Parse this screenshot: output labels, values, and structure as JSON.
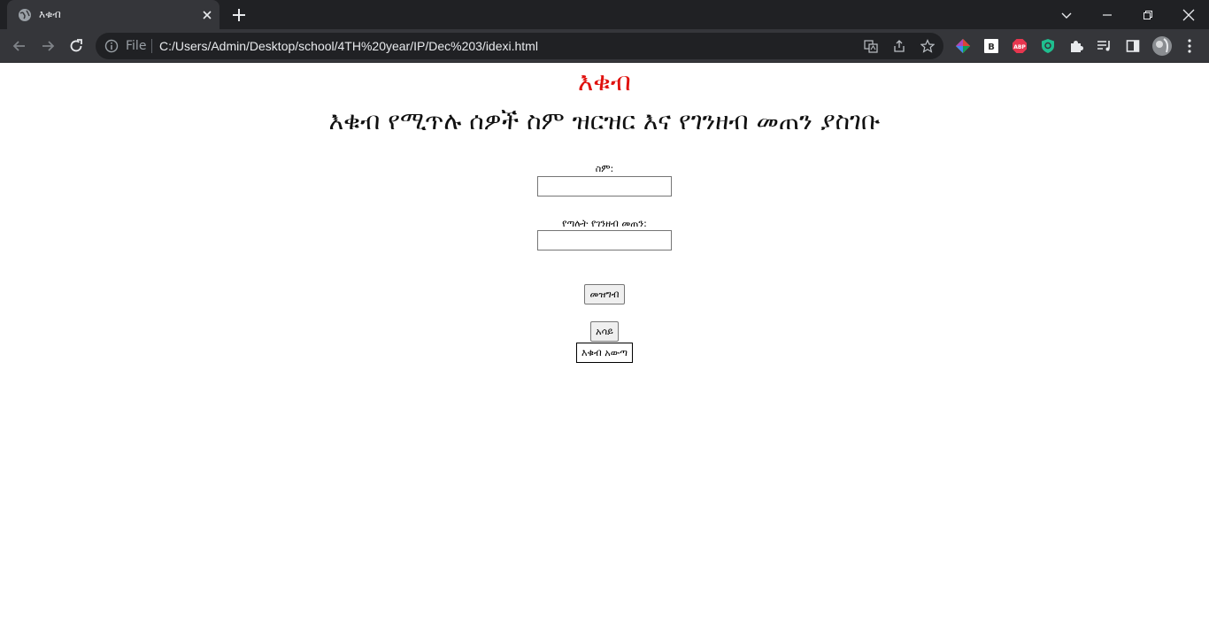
{
  "browser": {
    "tab_title": "እቁብ",
    "file_label": "File",
    "url": "C:/Users/Admin/Desktop/school/4TH%20year/IP/Dec%203/idexi.html"
  },
  "page": {
    "title": "እቁብ",
    "subtitle": "እቁብ የሚጥሉ ሰዎች ስም ዝርዝር እና የገንዘብ መጠን ያስገቡ",
    "name_label": "ስም:",
    "name_value": "",
    "amount_label": "የጣሉት የገንዘብ መጠን:",
    "amount_value": "",
    "register_button": "መዝግብ",
    "show_button": "አሳይ",
    "draw_output": "እቁብ አውጣ"
  }
}
